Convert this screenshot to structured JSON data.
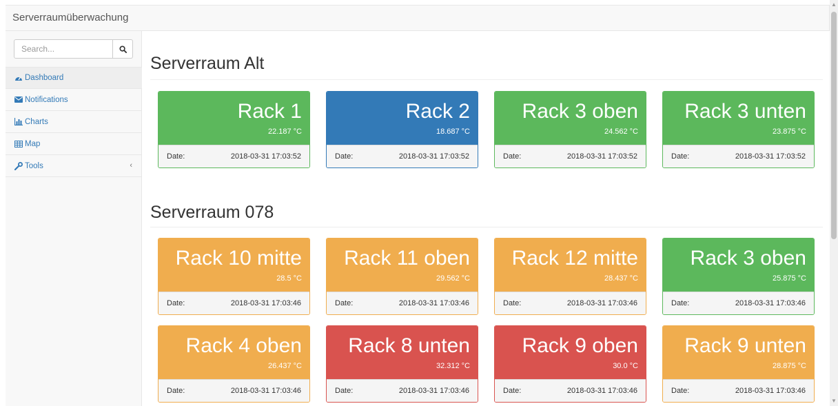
{
  "app": {
    "brand": "Serverraumüberwachung"
  },
  "search": {
    "placeholder": "Search..."
  },
  "sidebar": {
    "items": [
      {
        "label": "Dashboard",
        "icon": "dashboard-icon"
      },
      {
        "label": "Notifications",
        "icon": "envelope-icon"
      },
      {
        "label": "Charts",
        "icon": "bar-chart-icon"
      },
      {
        "label": "Map",
        "icon": "table-icon"
      },
      {
        "label": "Tools",
        "icon": "wrench-icon",
        "caret": "‹"
      }
    ]
  },
  "colors": {
    "ok": "#5cb85c",
    "info": "#337ab7",
    "warning": "#f0ad4e",
    "danger": "#d9534f"
  },
  "sections": [
    {
      "title": "Serverraum Alt",
      "date_label": "Date:",
      "racks": [
        {
          "name": "Rack 1",
          "temp": "22.187 °C",
          "date": "2018-03-31 17:03:52",
          "status": "green"
        },
        {
          "name": "Rack 2",
          "temp": "18.687 °C",
          "date": "2018-03-31 17:03:52",
          "status": "blue"
        },
        {
          "name": "Rack 3 oben",
          "temp": "24.562 °C",
          "date": "2018-03-31 17:03:52",
          "status": "green"
        },
        {
          "name": "Rack 3 unten",
          "temp": "23.875 °C",
          "date": "2018-03-31 17:03:52",
          "status": "green"
        }
      ]
    },
    {
      "title": "Serverraum 078",
      "date_label": "Date:",
      "racks": [
        {
          "name": "Rack 10 mitte",
          "temp": "28.5 °C",
          "date": "2018-03-31 17:03:46",
          "status": "orange"
        },
        {
          "name": "Rack 11 oben",
          "temp": "29.562 °C",
          "date": "2018-03-31 17:03:46",
          "status": "orange"
        },
        {
          "name": "Rack 12 mitte",
          "temp": "28.437 °C",
          "date": "2018-03-31 17:03:46",
          "status": "orange"
        },
        {
          "name": "Rack 3 oben",
          "temp": "25.875 °C",
          "date": "2018-03-31 17:03:46",
          "status": "green"
        },
        {
          "name": "Rack 4 oben",
          "temp": "26.437 °C",
          "date": "2018-03-31 17:03:46",
          "status": "orange"
        },
        {
          "name": "Rack 8 unten",
          "temp": "32.312 °C",
          "date": "2018-03-31 17:03:46",
          "status": "red"
        },
        {
          "name": "Rack 9 oben",
          "temp": "30.0 °C",
          "date": "2018-03-31 17:03:46",
          "status": "red"
        },
        {
          "name": "Rack 9 unten",
          "temp": "28.875 °C",
          "date": "2018-03-31 17:03:46",
          "status": "orange"
        }
      ]
    }
  ]
}
